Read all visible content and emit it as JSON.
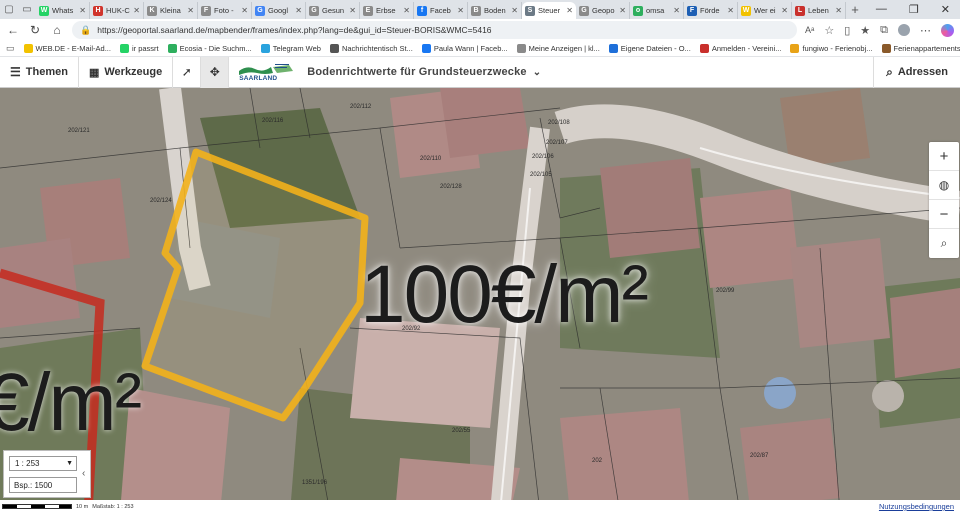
{
  "browser": {
    "tabs": [
      {
        "title": "Whats",
        "color": "#25d366",
        "glyph": "W",
        "active": false
      },
      {
        "title": "HUK-C",
        "color": "#d0342c",
        "glyph": "H",
        "active": false
      },
      {
        "title": "Kleina",
        "color": "#8a8a8a",
        "glyph": "K",
        "active": false
      },
      {
        "title": "Foto -",
        "color": "#8a8a8a",
        "glyph": "F",
        "active": false
      },
      {
        "title": "Googl",
        "color": "#4285f4",
        "glyph": "G",
        "active": false
      },
      {
        "title": "Gesun",
        "color": "#8a8a8a",
        "glyph": "G",
        "active": false
      },
      {
        "title": "Erbse",
        "color": "#8a8a8a",
        "glyph": "E",
        "active": false
      },
      {
        "title": "Faceb",
        "color": "#1877f2",
        "glyph": "f",
        "active": false
      },
      {
        "title": "Boden",
        "color": "#8a8a8a",
        "glyph": "B",
        "active": false
      },
      {
        "title": "Steuer",
        "color": "#6c7a86",
        "glyph": "S",
        "active": true
      },
      {
        "title": "Geopo",
        "color": "#8a8a8a",
        "glyph": "G",
        "active": false
      },
      {
        "title": "omsa",
        "color": "#2eaf5e",
        "glyph": "o",
        "active": false
      },
      {
        "title": "Förde",
        "color": "#1d5fb4",
        "glyph": "F",
        "active": false
      },
      {
        "title": "Wer ei",
        "color": "#f2c200",
        "glyph": "W",
        "active": false
      },
      {
        "title": "Leben",
        "color": "#c9302c",
        "glyph": "L",
        "active": false
      }
    ],
    "url": "https://geoportal.saarland.de/mapbender/frames/index.php?lang=de&gui_id=Steuer-BORIS&WMC=5416",
    "bookmarks": [
      {
        "label": "WEB.DE - E-Mail-Ad...",
        "color": "#f2c200"
      },
      {
        "label": "ir passrt",
        "color": "#25d366"
      },
      {
        "label": "Ecosia - Die Suchm...",
        "color": "#2eaf5e"
      },
      {
        "label": "Telegram Web",
        "color": "#2aa3de"
      },
      {
        "label": "Nachrichtentisch St...",
        "color": "#555555"
      },
      {
        "label": "Paula Wann | Faceb...",
        "color": "#1877f2"
      },
      {
        "label": "Meine Anzeigen | kl...",
        "color": "#8a8a8a"
      },
      {
        "label": "Eigene Dateien - O...",
        "color": "#1e6fd9"
      },
      {
        "label": "Anmelden - Vereini...",
        "color": "#c9302c"
      },
      {
        "label": "fungiwo - Ferienobj...",
        "color": "#e8a317"
      },
      {
        "label": "Ferienappartements...",
        "color": "#8a5a2b"
      }
    ]
  },
  "toolbar": {
    "themes_label": "Themen",
    "tools_label": "Werkzeuge",
    "logo_text": "SAARLAND",
    "title": "Bodenrichtwerte für Grundsteuerzwecke",
    "address_label": "Adressen"
  },
  "map": {
    "price_main": "100€/m²",
    "price_left": "€/m²",
    "plot_labels": [
      "202/121",
      "202/116",
      "202/112",
      "202/110",
      "202/128",
      "202/108",
      "202/107",
      "202/106",
      "202/105",
      "202/124",
      "202/99",
      "202/92",
      "202/87",
      "202/55",
      "1351/196",
      "202"
    ],
    "scale_value": "1 : 253",
    "scale_input": "Bsp.: 1500",
    "scalebar_label": "10 m",
    "scale_text": "Maßstab: 1 : 253",
    "terms_label": "Nutzungsbedingungen"
  }
}
